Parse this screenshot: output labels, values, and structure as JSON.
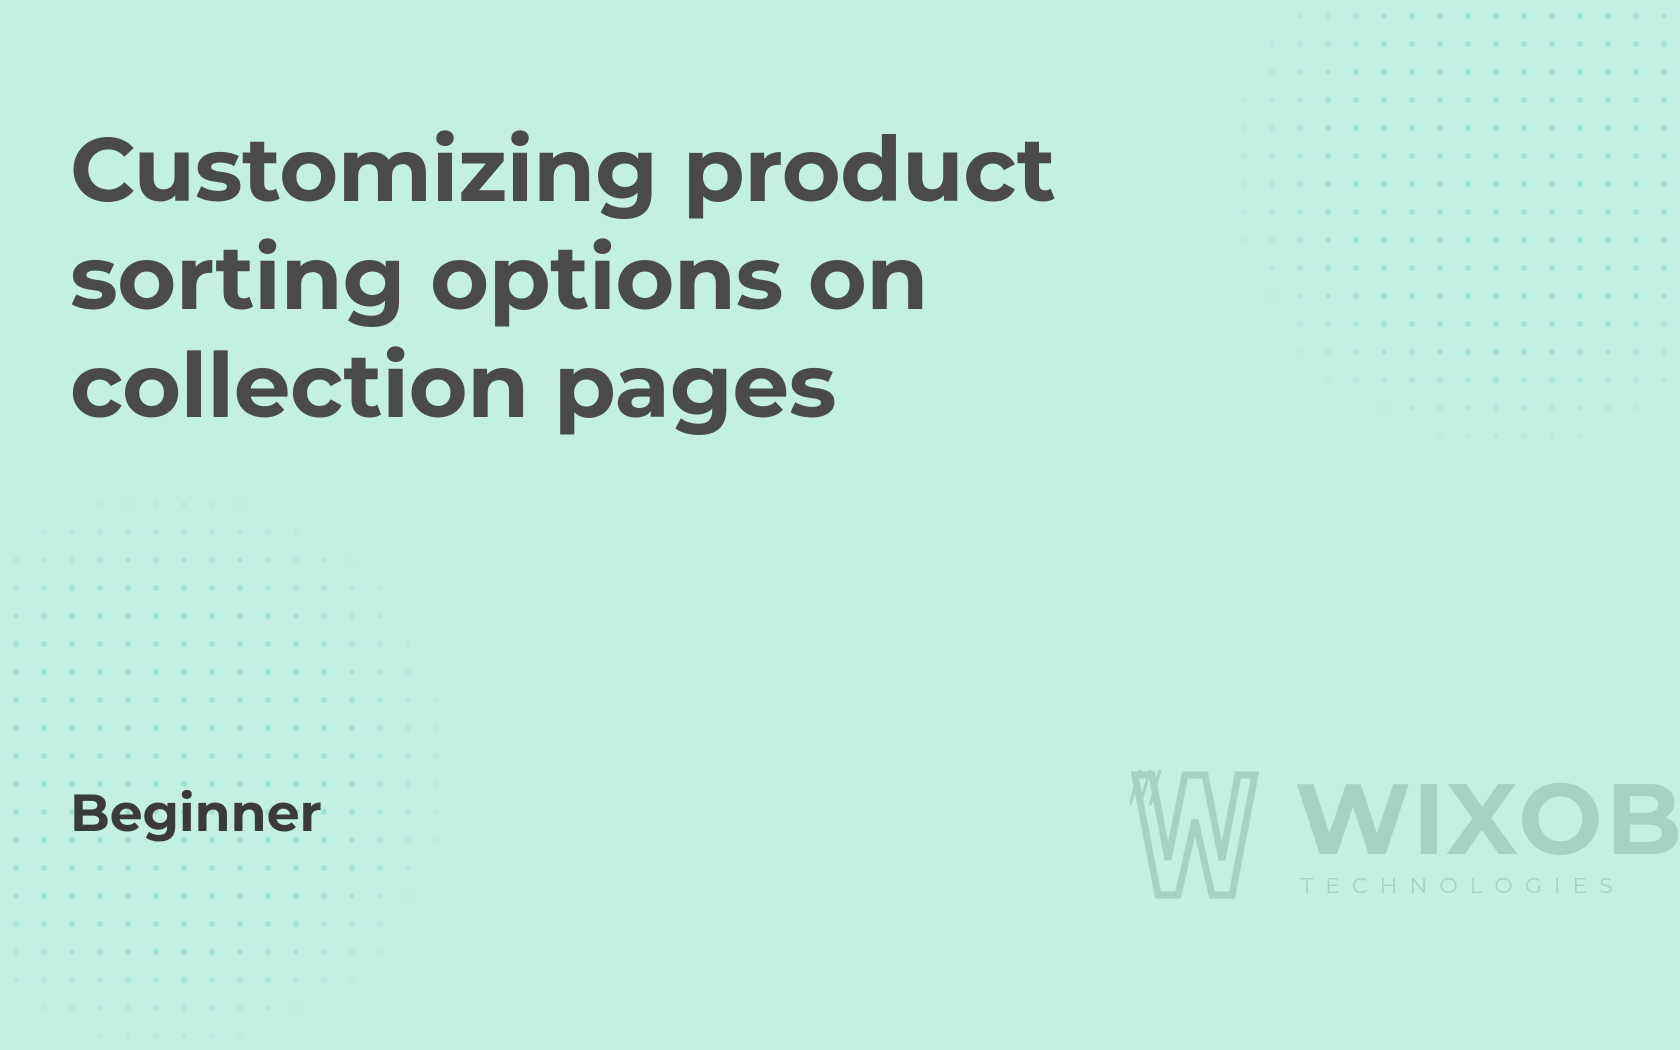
{
  "title": "Customizing product sorting options on collection pages",
  "level": "Beginner",
  "watermark": {
    "brand": "WIXOB",
    "subtitle": "TECHNOLOGIES"
  }
}
